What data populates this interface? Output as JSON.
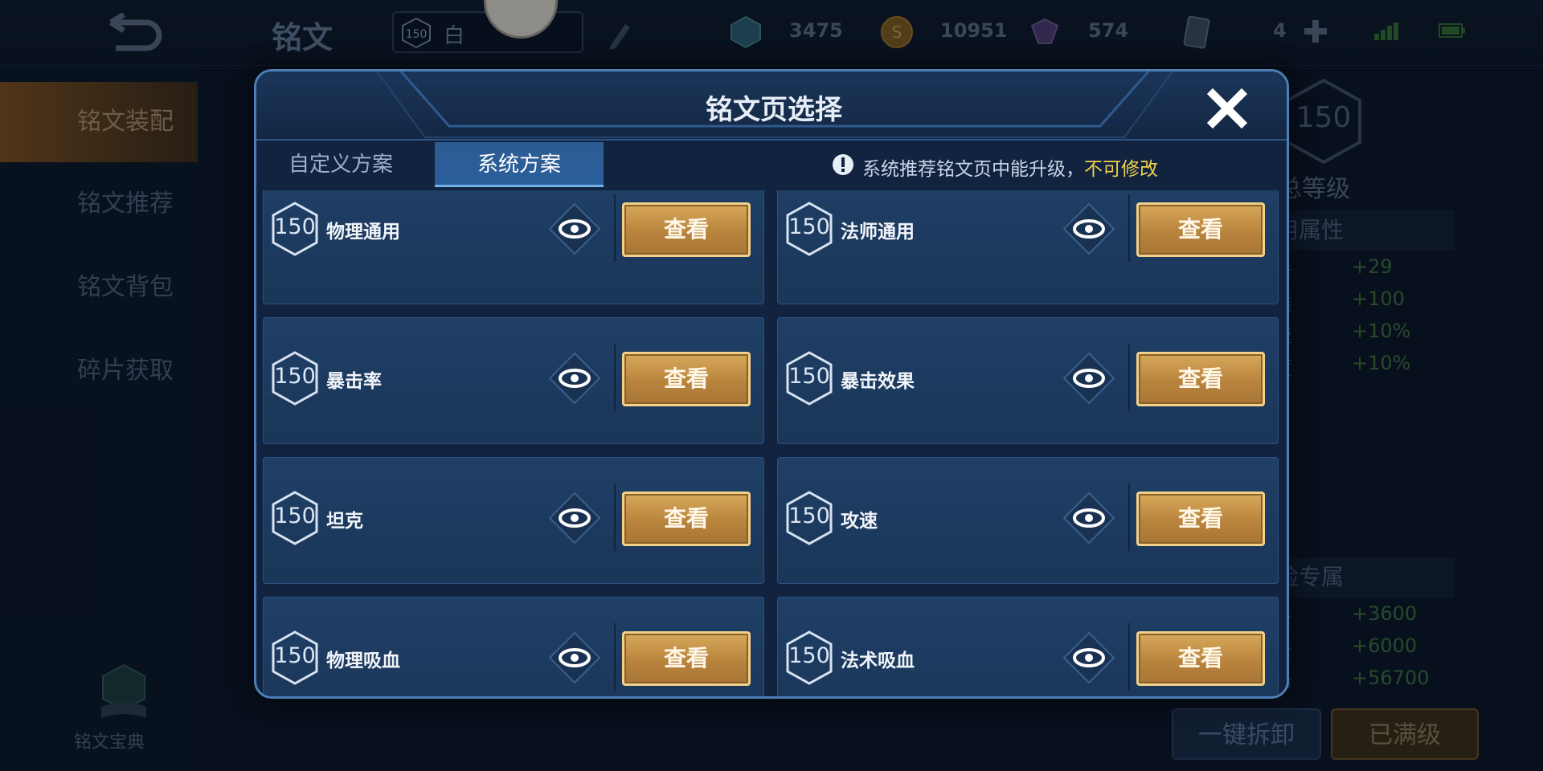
{
  "topbar": {
    "title": "铭文",
    "player_level": "150",
    "player_name": "白",
    "currencies": {
      "gem": "3475",
      "coin": "10951",
      "purple": "574",
      "ticket": "4"
    }
  },
  "sidebar": {
    "items": [
      {
        "label": "铭文装配",
        "active": true
      },
      {
        "label": "铭文推荐",
        "active": false
      },
      {
        "label": "铭文背包",
        "active": false
      },
      {
        "label": "碎片获取",
        "active": false
      }
    ],
    "codex_label": "铭文宝典"
  },
  "right_panel": {
    "total_level": "150",
    "total_level_label": "文总等级",
    "section_general": "通用属性",
    "general_stats": [
      {
        "k": "攻击",
        "v": "+29"
      },
      {
        "k": "穿透",
        "v": "+100"
      },
      {
        "k": "攻速",
        "v": "+10%"
      },
      {
        "k": "速度",
        "v": "+10%"
      }
    ],
    "section_adventure": "冒险专属",
    "adventure_stats": [
      {
        "k": "攻击",
        "v": "+3600"
      },
      {
        "k": "攻击",
        "v": "+6000"
      },
      {
        "k": "生命",
        "v": "+56700"
      }
    ],
    "unload_label": "一键拆卸",
    "maxed_label": "已满级"
  },
  "modal": {
    "title": "铭文页选择",
    "tabs": [
      {
        "label": "自定义方案",
        "active": false
      },
      {
        "label": "系统方案",
        "active": true
      }
    ],
    "notice": "系统推荐铭文页中能升级，",
    "notice_warn": "不可修改",
    "pages": [
      {
        "level": "150",
        "name": "物理通用",
        "button": "查看"
      },
      {
        "level": "150",
        "name": "法师通用",
        "button": "查看"
      },
      {
        "level": "150",
        "name": "暴击率",
        "button": "查看"
      },
      {
        "level": "150",
        "name": "暴击效果",
        "button": "查看"
      },
      {
        "level": "150",
        "name": "坦克",
        "button": "查看"
      },
      {
        "level": "150",
        "name": "攻速",
        "button": "查看"
      },
      {
        "level": "150",
        "name": "物理吸血",
        "button": "查看"
      },
      {
        "level": "150",
        "name": "法术吸血",
        "button": "查看"
      }
    ]
  },
  "colors": {
    "accent_gold": "#d7a85a",
    "modal_border": "#4c7fb8",
    "warn_yellow": "#f0d24a",
    "stat_green": "#3b6e39"
  }
}
